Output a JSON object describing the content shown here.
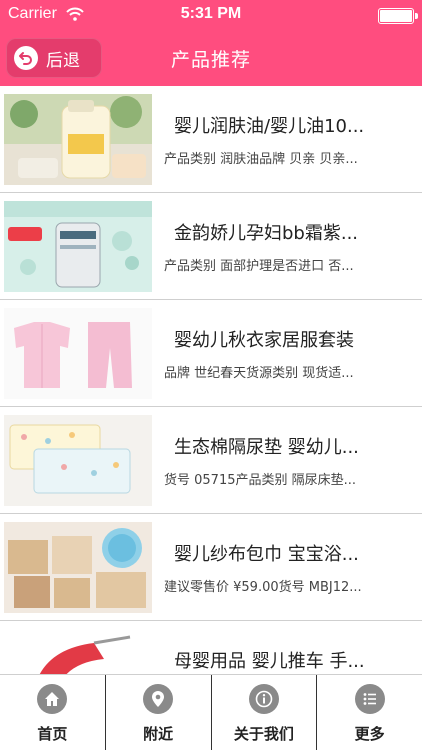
{
  "status_bar": {
    "carrier": "Carrier",
    "time": "5:31 PM"
  },
  "nav": {
    "back_label": "后退",
    "title": "产品推荐"
  },
  "products": [
    {
      "title": "婴儿润肤油/婴儿油10...",
      "desc": "产品类别 润肤油品牌 贝亲 贝亲..."
    },
    {
      "title": "金韵娇儿孕妇bb霜紫...",
      "desc": "产品类别 面部护理是否进口 否..."
    },
    {
      "title": "婴幼儿秋衣家居服套装",
      "desc": "品牌 世纪春天货源类别 现货适..."
    },
    {
      "title": "生态棉隔尿垫 婴幼儿...",
      "desc": "货号 05715产品类别 隔尿床垫..."
    },
    {
      "title": "婴儿纱布包巾 宝宝浴...",
      "desc": "建议零售价 ¥59.00货号 MBJ12..."
    },
    {
      "title": "母婴用品 婴儿推车 手...",
      "desc": ""
    }
  ],
  "tabs": [
    {
      "label": "首页",
      "icon": "home-icon"
    },
    {
      "label": "附近",
      "icon": "location-pin-icon"
    },
    {
      "label": "关于我们",
      "icon": "info-icon"
    },
    {
      "label": "更多",
      "icon": "list-icon"
    }
  ],
  "colors": {
    "brand": "#ff4d7f",
    "back_button": "#e43c6c",
    "tab_icon": "#8a8a8a"
  }
}
